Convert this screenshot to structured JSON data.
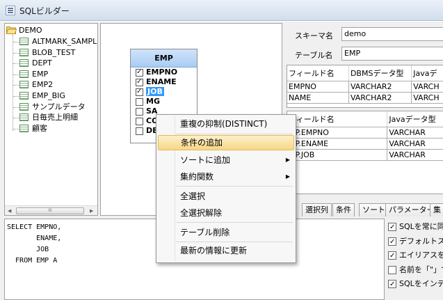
{
  "window": {
    "title": "SQLビルダー"
  },
  "tree": {
    "root": "DEMO",
    "items": [
      "ALTMARK_SAMPL",
      "BLOB_TEST",
      "DEPT",
      "EMP",
      "EMP2",
      "EMP_BIG",
      "サンプルデータ",
      "日毎売上明細",
      "顧客"
    ],
    "scroll_thumb": "III"
  },
  "emp_table": {
    "title": "EMP",
    "columns": [
      {
        "name": "EMPNO",
        "checked": true
      },
      {
        "name": "ENAME",
        "checked": true
      },
      {
        "name": "JOB",
        "checked": true
      },
      {
        "name": "MG",
        "checked": false
      },
      {
        "name": "SA",
        "checked": false
      },
      {
        "name": "CO",
        "checked": false
      },
      {
        "name": "DE",
        "checked": false
      }
    ]
  },
  "props": {
    "schema_label": "スキーマ名",
    "schema_value": "demo",
    "table_label": "テーブル名",
    "table_value": "EMP"
  },
  "field_grid": {
    "headers": [
      "フィールド名",
      "DBMSデータ型",
      "Javaデ"
    ],
    "rows": [
      [
        "EMPNO",
        "VARCHAR2",
        "VARCH"
      ],
      [
        "NAME",
        "VARCHAR2",
        "VARCH"
      ]
    ]
  },
  "select_grid": {
    "headers": [
      "フィールド名",
      "Javaデータ型"
    ],
    "rows": [
      [
        "MP.EMPNO",
        "VARCHAR"
      ],
      [
        "MP.ENAME",
        "VARCHAR"
      ],
      [
        "MP.JOB",
        "VARCHAR"
      ]
    ]
  },
  "tabs": [
    "選択列",
    "条件",
    "ソート",
    "パラメーター",
    "集"
  ],
  "sql_text": "SELECT EMPNO,\n       ENAME,\n       JOB\n  FROM EMP A",
  "options": [
    {
      "label": "SQLを常に同",
      "checked": true
    },
    {
      "label": "デフォルトスキ",
      "checked": true
    },
    {
      "label": "エイリアスを使",
      "checked": true
    },
    {
      "label": "名前を「\"」で",
      "checked": false
    },
    {
      "label": "SQLをインデン",
      "checked": true
    }
  ],
  "context_menu": {
    "items": [
      {
        "label": "重複の抑制(DISTINCT)",
        "submenu": false
      },
      {
        "label": "条件の追加",
        "submenu": false,
        "highlighted": true
      },
      {
        "label": "ソートに追加",
        "submenu": true
      },
      {
        "label": "集約関数",
        "submenu": true
      },
      {
        "label": "全選択",
        "submenu": false
      },
      {
        "label": "全選択解除",
        "submenu": false
      },
      {
        "label": "テーブル削除",
        "submenu": false
      },
      {
        "label": "最新の情報に更新",
        "submenu": false
      }
    ],
    "submenu_glyph": "▶"
  },
  "colors": {
    "highlight": "#f6d788",
    "selection": "#3399ff",
    "header": "#a9ccf3"
  }
}
